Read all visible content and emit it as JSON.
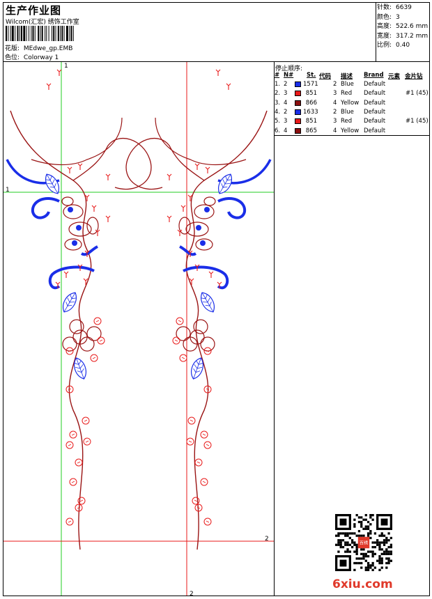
{
  "header": {
    "title": "生产作业图",
    "company": "Wilcom(汇宏) 绣饰工作室",
    "design_label": "花版:",
    "design_value": "MEdwe_gp.EMB",
    "colorway_label": "色位:",
    "colorway_value": "Colorway 1"
  },
  "stats": [
    {
      "label": "针数:",
      "value": "6639"
    },
    {
      "label": "颜色:",
      "value": "3"
    },
    {
      "label": "高度:",
      "value": "522.6 mm"
    },
    {
      "label": "宽度:",
      "value": "317.2 mm"
    },
    {
      "label": "比例:",
      "value": "0.40"
    }
  ],
  "stop_sequence": {
    "title": "停止顺序:",
    "columns": [
      "#",
      "N#",
      "St.",
      "代码",
      "描述",
      "Brand",
      "元素",
      "金片钻"
    ],
    "rows": [
      {
        "num": "1.",
        "n": "2",
        "color": "#1a2ee8",
        "st": "1571",
        "code": "2",
        "desc": "Blue",
        "brand": "Default",
        "elem": "",
        "seq": ""
      },
      {
        "num": "2.",
        "n": "3",
        "color": "#e81a1a",
        "st": "851",
        "code": "3",
        "desc": "Red",
        "brand": "Default",
        "elem": "",
        "seq": "#1 (45)"
      },
      {
        "num": "3.",
        "n": "4",
        "color": "#8b1010",
        "st": "866",
        "code": "4",
        "desc": "Yellow",
        "brand": "Default",
        "elem": "",
        "seq": ""
      },
      {
        "num": "4.",
        "n": "2",
        "color": "#1a2ee8",
        "st": "1633",
        "code": "2",
        "desc": "Blue",
        "brand": "Default",
        "elem": "",
        "seq": ""
      },
      {
        "num": "5.",
        "n": "3",
        "color": "#e81a1a",
        "st": "851",
        "code": "3",
        "desc": "Red",
        "brand": "Default",
        "elem": "",
        "seq": "#1 (45)"
      },
      {
        "num": "6.",
        "n": "4",
        "color": "#8b1010",
        "st": "865",
        "code": "4",
        "desc": "Yellow",
        "brand": "Default",
        "elem": "",
        "seq": ""
      }
    ]
  },
  "markers": {
    "one": "1",
    "two": "2"
  },
  "watermark": "6xiu.com",
  "qr_seal": "百绣"
}
